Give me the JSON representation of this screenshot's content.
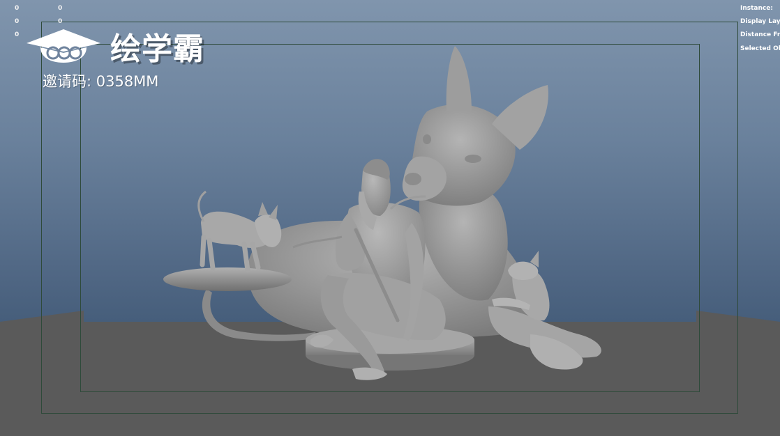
{
  "hud_left": {
    "rows": [
      [
        "0",
        "0"
      ],
      [
        "0",
        "0"
      ],
      [
        "0",
        "0"
      ]
    ]
  },
  "hud_right": {
    "lines": [
      "Instance:",
      "Display Laye",
      "Distance Fro",
      "Selected Ob"
    ]
  },
  "watermark": {
    "brand": "绘学霸",
    "invite_code": "邀请码: 0358MM"
  },
  "colors": {
    "viewport_top": "#8095ad",
    "viewport_bottom": "#465e7b",
    "ground": "#5a5a5a",
    "model": "#9a9a9a",
    "gate": "#2e4a3a"
  }
}
